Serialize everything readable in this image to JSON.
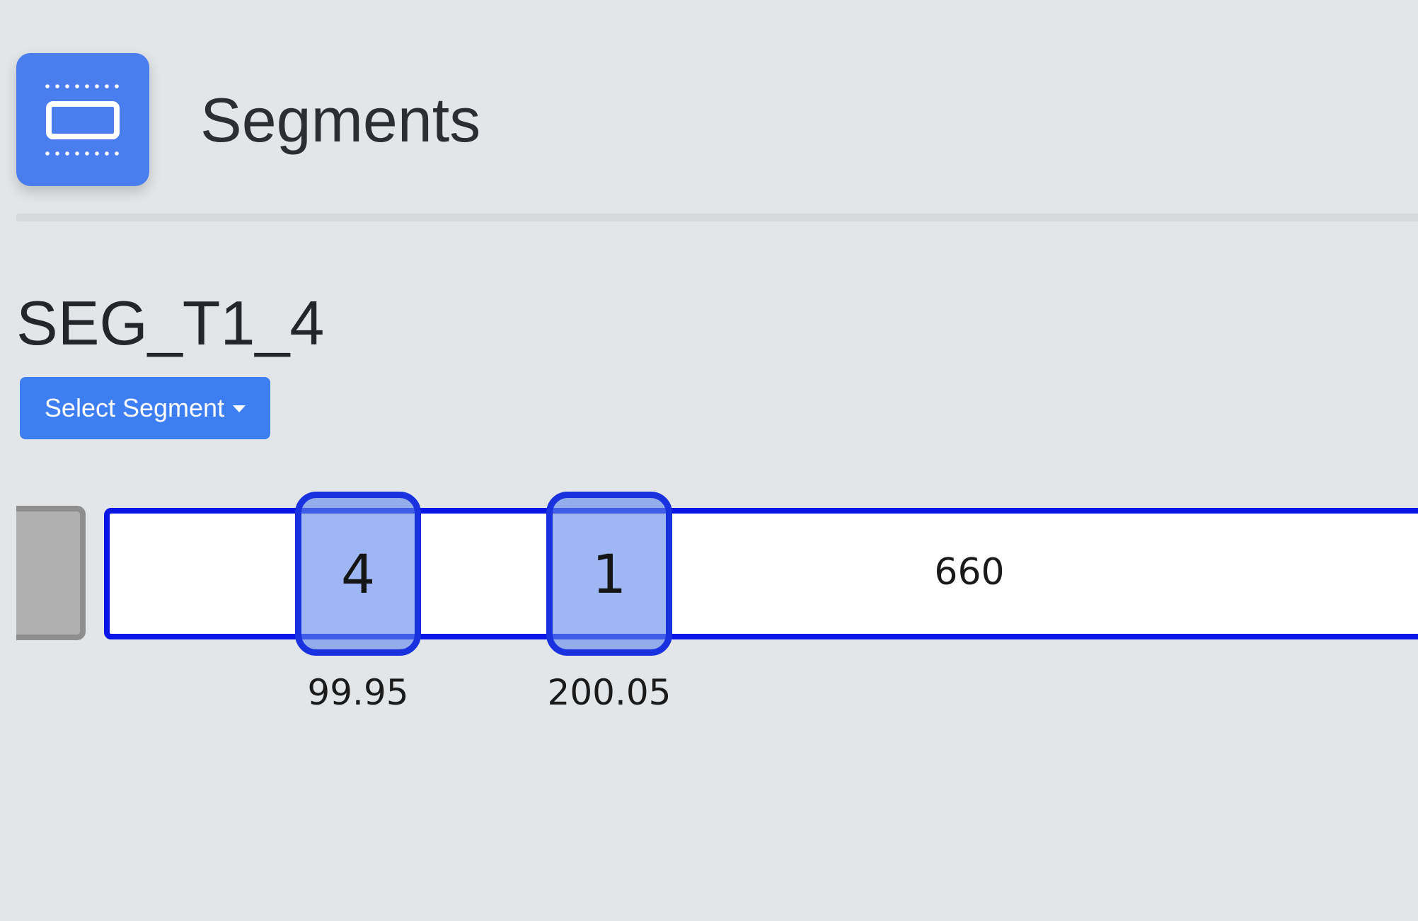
{
  "header": {
    "icon": "segments-icon",
    "icon_color": "#4a7eee",
    "title": "Segments"
  },
  "segment": {
    "name": "SEG_T1_4",
    "select_label": "Select Segment",
    "length": "660"
  },
  "markers": [
    {
      "label": "4",
      "position": "99.95"
    },
    {
      "label": "1",
      "position": "200.05"
    }
  ],
  "colors": {
    "accent": "#3e7ef3",
    "track_border": "#0a16e8",
    "marker_fill": "#6289eb",
    "background": "#e3e6e8"
  }
}
